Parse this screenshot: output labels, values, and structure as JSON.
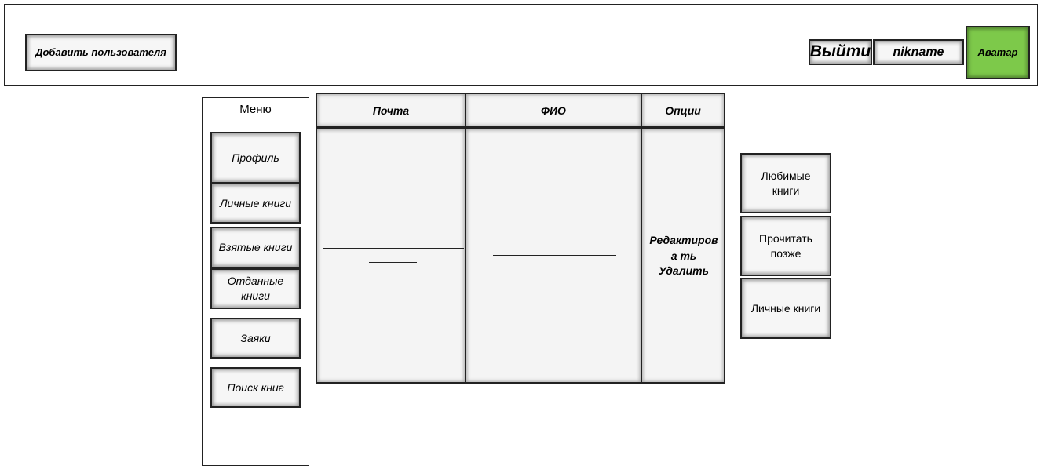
{
  "header": {
    "add_user_label": "Добавить пользователя",
    "logout_label": "Выйти",
    "nickname_label": "nikname",
    "avatar_label": "Аватар",
    "avatar_color": "#7dc94a"
  },
  "menu": {
    "title": "Меню",
    "items": [
      {
        "label": "Профиль"
      },
      {
        "label": "Личные книги"
      },
      {
        "label": "Взятые книги"
      },
      {
        "label": "Отданные книги"
      },
      {
        "label": "Заяки"
      },
      {
        "label": "Поиск книг"
      }
    ]
  },
  "table": {
    "columns": [
      "Почта",
      "ФИО",
      "Опции"
    ],
    "options": {
      "edit_label": "Редактирова ть",
      "delete_label": "Удалить"
    }
  },
  "side_buttons": [
    {
      "label": "Любимые книги"
    },
    {
      "label": "Прочитать позже"
    },
    {
      "label": "Личные книги"
    }
  ]
}
